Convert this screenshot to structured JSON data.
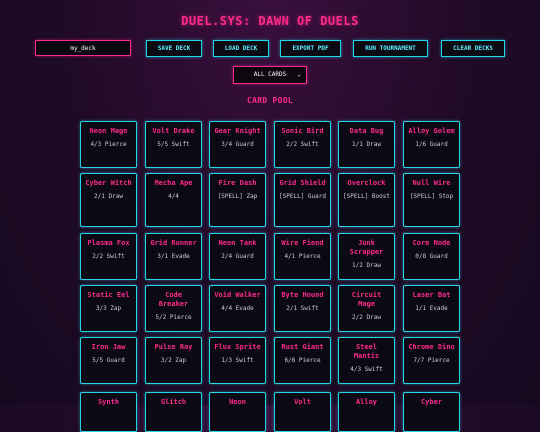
{
  "app": {
    "title": "DUEL.SYS: DAWN OF DUELS"
  },
  "toolbar": {
    "deck_name_value": "my_deck",
    "buttons": [
      "SAVE DECK",
      "LOAD DECK",
      "EXPORT PDF",
      "RUN TOURNAMENT",
      "CLEAR DECKS"
    ]
  },
  "filter": {
    "selected": "ALL CARDS"
  },
  "pool": {
    "title": "CARD POOL",
    "cards": [
      {
        "name": "Neon Mage",
        "stats": "4/3 Pierce"
      },
      {
        "name": "Volt Drake",
        "stats": "5/5 Swift"
      },
      {
        "name": "Gear Knight",
        "stats": "3/4 Guard"
      },
      {
        "name": "Sonic Bird",
        "stats": "2/2 Swift"
      },
      {
        "name": "Data Bug",
        "stats": "1/1 Draw"
      },
      {
        "name": "Alloy Golem",
        "stats": "1/6 Guard"
      },
      {
        "name": "Cyber Witch",
        "stats": "2/1 Draw"
      },
      {
        "name": "Mecha Ape",
        "stats": "4/4"
      },
      {
        "name": "Fire Dash",
        "stats": "[SPELL] Zap"
      },
      {
        "name": "Grid Shield",
        "stats": "[SPELL] Guard"
      },
      {
        "name": "Overclock",
        "stats": "[SPELL] Boost"
      },
      {
        "name": "Null Wire",
        "stats": "[SPELL] Stop"
      },
      {
        "name": "Plasma Fox",
        "stats": "2/2 Swift"
      },
      {
        "name": "Grid Runner",
        "stats": "3/1 Evade"
      },
      {
        "name": "Neon Tank",
        "stats": "2/4 Guard"
      },
      {
        "name": "Wire Fiend",
        "stats": "4/1 Pierce"
      },
      {
        "name": "Junk Scrapper",
        "stats": "1/2 Draw"
      },
      {
        "name": "Core Node",
        "stats": "0/8 Guard"
      },
      {
        "name": "Static Eel",
        "stats": "3/3 Zap"
      },
      {
        "name": "Code Breaker",
        "stats": "5/2 Pierce"
      },
      {
        "name": "Void Walker",
        "stats": "4/4 Evade"
      },
      {
        "name": "Byte Hound",
        "stats": "2/1 Swift"
      },
      {
        "name": "Circuit Mage",
        "stats": "2/2 Draw"
      },
      {
        "name": "Laser Bat",
        "stats": "1/1 Evade"
      },
      {
        "name": "Iron Jaw",
        "stats": "5/5 Guard"
      },
      {
        "name": "Pulse Ray",
        "stats": "3/2 Zap"
      },
      {
        "name": "Flux Sprite",
        "stats": "1/3 Swift"
      },
      {
        "name": "Rust Giant",
        "stats": "6/6 Pierce"
      },
      {
        "name": "Steel Mantis",
        "stats": "4/3 Swift"
      },
      {
        "name": "Chrome Dino",
        "stats": "7/7 Pierce"
      },
      {
        "name": "Synth",
        "stats": ""
      },
      {
        "name": "Glitch",
        "stats": ""
      },
      {
        "name": "Neon",
        "stats": ""
      },
      {
        "name": "Volt",
        "stats": ""
      },
      {
        "name": "Alloy",
        "stats": ""
      },
      {
        "name": "Cyber",
        "stats": ""
      }
    ]
  },
  "colors": {
    "accent_pink": "#ff2a8c",
    "accent_cyan": "#25d6e8",
    "background": "#1f0a25"
  }
}
